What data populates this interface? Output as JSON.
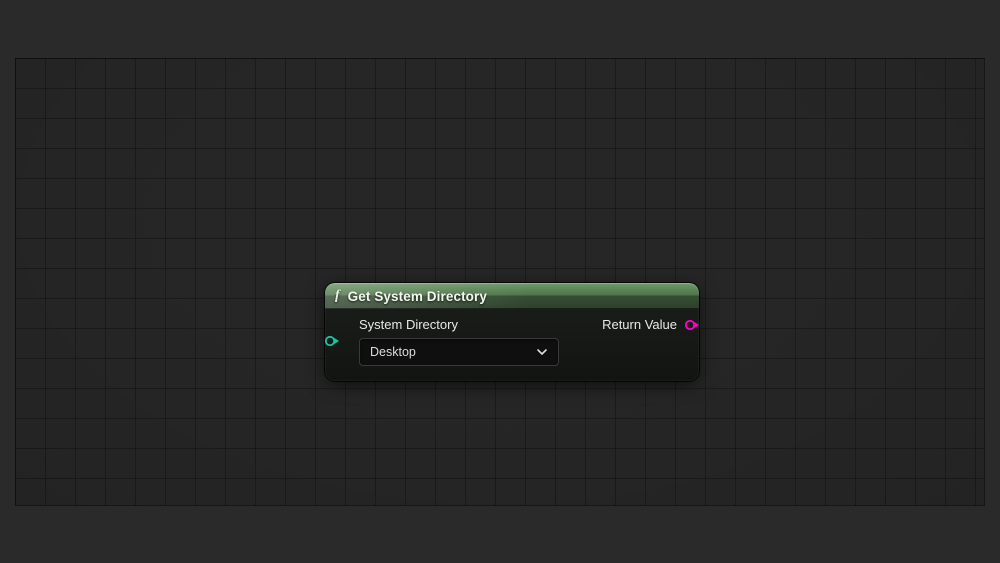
{
  "node": {
    "title": "Get System Directory",
    "input": {
      "label": "System Directory",
      "dropdown_value": "Desktop",
      "pin_color": "#13c7a3"
    },
    "output": {
      "label": "Return Value",
      "pin_color": "#ff00c8"
    }
  }
}
